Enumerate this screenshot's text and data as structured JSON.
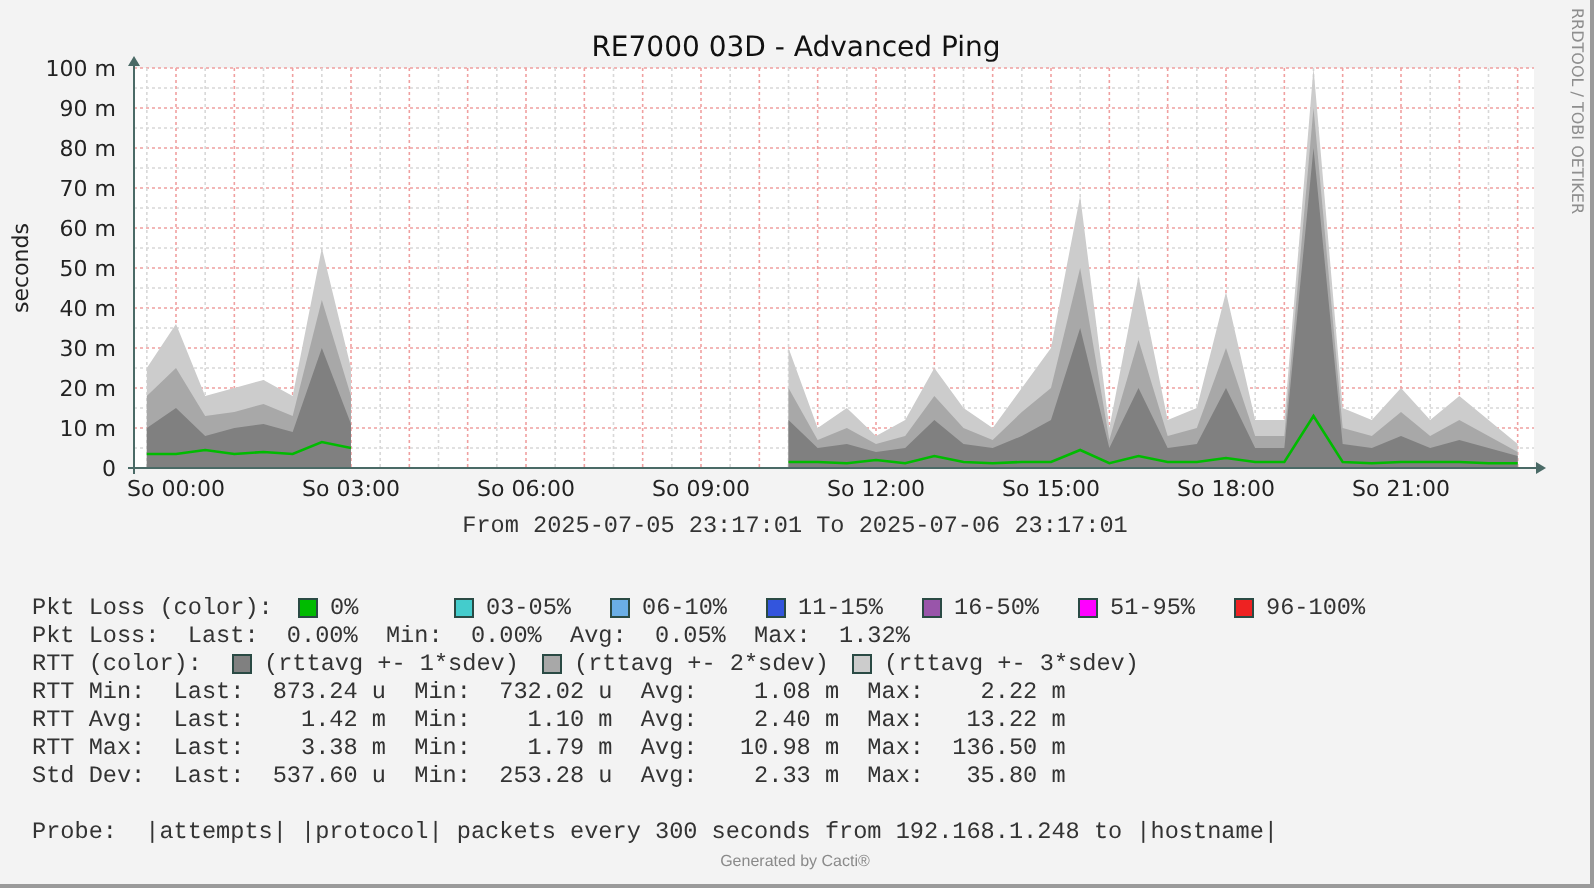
{
  "graph": {
    "side_label": "RRDTOOL / TOBI OETIKER",
    "chart_data": {
      "type": "area",
      "grid": true,
      "title": "RE7000 03D - Advanced Ping",
      "ylabel": "seconds",
      "ylim": [
        0,
        100
      ],
      "categories": [
        null,
        "So 00:00",
        null,
        null,
        null,
        null,
        null,
        "So 03:00",
        null,
        null,
        null,
        null,
        null,
        "So 06:00",
        null,
        null,
        null,
        null,
        null,
        "So 09:00",
        null,
        null,
        null,
        null,
        null,
        "So 12:00",
        null,
        null,
        null,
        null,
        null,
        "So 15:00",
        null,
        null,
        null,
        null,
        null,
        "So 18:00",
        null,
        null,
        null,
        null,
        null,
        "So 21:00",
        null,
        null,
        null,
        null
      ],
      "yticks": [
        {
          "value": 0,
          "label": "0"
        },
        {
          "value": 10,
          "label": "10 m"
        },
        {
          "value": 20,
          "label": "20 m"
        },
        {
          "value": 30,
          "label": "30 m"
        },
        {
          "value": 40,
          "label": "40 m"
        },
        {
          "value": 50,
          "label": "50 m"
        },
        {
          "value": 60,
          "label": "60 m"
        },
        {
          "value": 70,
          "label": "70 m"
        },
        {
          "value": 80,
          "label": "80 m"
        },
        {
          "value": 90,
          "label": "90 m"
        },
        {
          "value": 100,
          "label": "100 m"
        }
      ],
      "series": [
        {
          "name": "(rttavg +- 1*sdev)",
          "color": "#808080",
          "values": [
            10,
            15,
            8,
            10,
            11,
            9,
            30,
            11,
            null,
            null,
            null,
            null,
            null,
            null,
            null,
            null,
            null,
            null,
            null,
            null,
            null,
            null,
            12,
            5,
            6,
            4,
            5,
            12,
            6,
            5,
            8,
            12,
            35,
            5,
            20,
            5,
            6,
            20,
            5,
            5,
            80,
            6,
            5,
            8,
            5,
            7,
            5,
            3
          ]
        },
        {
          "name": "(rttavg +- 2*sdev)",
          "color": "#a8a8a8",
          "values": [
            18,
            25,
            13,
            14,
            16,
            13,
            42,
            18,
            null,
            null,
            null,
            null,
            null,
            null,
            null,
            null,
            null,
            null,
            null,
            null,
            null,
            null,
            20,
            7,
            10,
            6,
            8,
            18,
            10,
            7,
            14,
            20,
            50,
            7,
            32,
            8,
            10,
            30,
            8,
            8,
            90,
            10,
            8,
            14,
            8,
            12,
            8,
            4
          ]
        },
        {
          "name": "(rttavg +- 3*sdev)",
          "color": "#cccccc",
          "values": [
            25,
            36,
            18,
            20,
            22,
            18,
            55,
            25,
            null,
            null,
            null,
            null,
            null,
            null,
            null,
            null,
            null,
            null,
            null,
            null,
            null,
            null,
            30,
            10,
            15,
            8,
            12,
            25,
            15,
            10,
            20,
            30,
            68,
            10,
            48,
            12,
            15,
            44,
            12,
            12,
            100,
            15,
            12,
            20,
            12,
            18,
            12,
            6
          ]
        },
        {
          "type": "line",
          "color": "#00bb00",
          "values": [
            3.5,
            3.5,
            4.5,
            3.5,
            4,
            3.5,
            6.5,
            5,
            null,
            null,
            null,
            null,
            null,
            null,
            null,
            null,
            null,
            null,
            null,
            null,
            null,
            null,
            1.5,
            1.5,
            1.2,
            2,
            1.2,
            3,
            1.5,
            1.2,
            1.5,
            1.5,
            4.5,
            1.2,
            3,
            1.5,
            1.5,
            2.5,
            1.5,
            1.5,
            13,
            1.5,
            1.2,
            1.5,
            1.5,
            1.5,
            1.2,
            1.2
          ]
        }
      ]
    },
    "period": "From 2025-07-05 23:17:01 To 2025-07-06 23:17:01"
  },
  "legend": {
    "loss_colors": {
      "label": "Pkt Loss (color):",
      "items": [
        {
          "label": "0%",
          "color": "#00bb00"
        },
        {
          "label": "03-05%",
          "color": "#44cccc"
        },
        {
          "label": "06-10%",
          "color": "#6aaee6"
        },
        {
          "label": "11-15%",
          "color": "#3355dd"
        },
        {
          "label": "16-50%",
          "color": "#9955aa"
        },
        {
          "label": "51-95%",
          "color": "#ff00ff"
        },
        {
          "label": "96-100%",
          "color": "#ee2222"
        }
      ]
    },
    "loss_stats": "Pkt Loss:  Last:  0.00%  Min:  0.00%  Avg:  0.05%  Max:  1.32%",
    "rtt_colors_label": "RTT (color):",
    "rtt_stats": [
      "RTT Min:  Last:  873.24 u  Min:  732.02 u  Avg:    1.08 m  Max:    2.22 m",
      "RTT Avg:  Last:    1.42 m  Min:    1.10 m  Avg:    2.40 m  Max:   13.22 m",
      "RTT Max:  Last:    3.38 m  Min:    1.79 m  Avg:   10.98 m  Max:  136.50 m",
      "Std Dev:  Last:  537.60 u  Min:  253.28 u  Avg:    2.33 m  Max:   35.80 m"
    ],
    "probe": "Probe:  |attempts| |protocol| packets every 300 seconds from 192.168.1.248 to |hostname|"
  },
  "footer": "Generated by Cacti®"
}
